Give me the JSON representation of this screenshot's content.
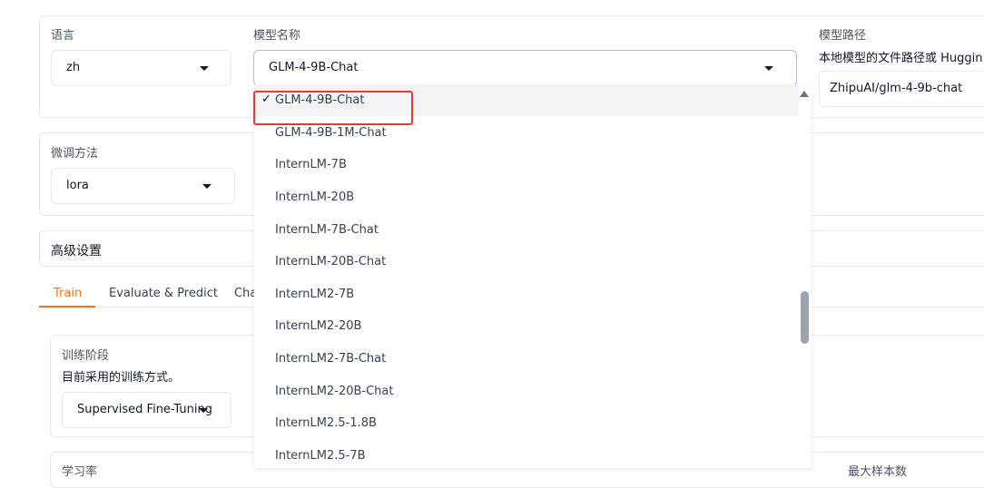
{
  "top_row": {
    "language": {
      "label": "语言",
      "value": "zh"
    },
    "model_name": {
      "label": "模型名称",
      "value": "GLM-4-9B-Chat"
    },
    "model_path": {
      "label": "模型路径",
      "info": "本地模型的文件路径或 Huggin",
      "value": "ZhipuAI/glm-4-9b-chat"
    }
  },
  "finetune": {
    "label": "微调方法",
    "value": "lora"
  },
  "advanced": {
    "label": "高级设置"
  },
  "tabs": [
    {
      "label": "Train",
      "active": true
    },
    {
      "label": "Evaluate & Predict",
      "active": false
    },
    {
      "label": "Cha",
      "active": false
    }
  ],
  "train": {
    "stage_label": "训练阶段",
    "stage_info": "目前采用的训练方式。",
    "stage_value": "Supervised Fine-Tuning",
    "bottom_left_label": "学习率",
    "bottom_right_label": "最大样本数"
  },
  "dropdown": {
    "selected_mark": "✓",
    "options": [
      "GLM-4-9B-Chat",
      "GLM-4-9B-1M-Chat",
      "InternLM-7B",
      "InternLM-20B",
      "InternLM-7B-Chat",
      "InternLM-20B-Chat",
      "InternLM2-7B",
      "InternLM2-20B",
      "InternLM2-7B-Chat",
      "InternLM2-20B-Chat",
      "InternLM2.5-1.8B",
      "InternLM2.5-7B"
    ],
    "selected_index": 0
  },
  "colors": {
    "accent": "#f97316",
    "highlight": "#e53935"
  }
}
